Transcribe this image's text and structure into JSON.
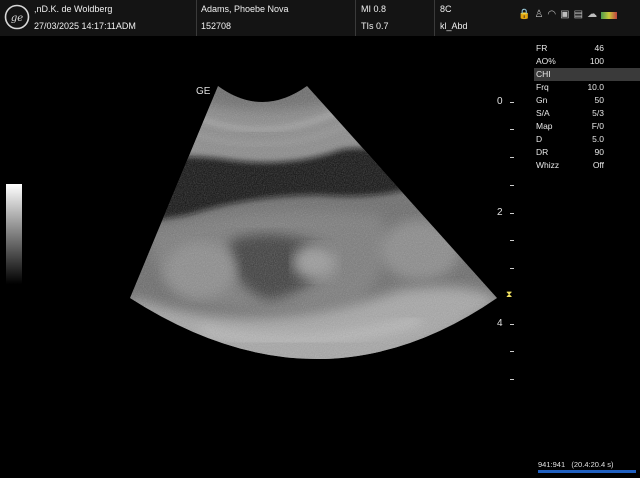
{
  "header": {
    "operator": ",nD.K. de Woldberg",
    "datetime": "27/03/2025 14:17:11ADM",
    "patient_name": "Adams, Phoebe Nova",
    "patient_id": "152708",
    "mi": "MI 0.8",
    "tis": "TIs 0.7",
    "probe": "8C",
    "preset": "kl_Abd"
  },
  "header_icons": [
    "lock-icon",
    "person-icon",
    "wifi-icon",
    "printer-icon",
    "image-store-icon",
    "cloud-icon",
    "palette-icon"
  ],
  "probe_mark": "GE",
  "depth_scale": [
    "0",
    "2",
    "4"
  ],
  "parameters": [
    {
      "label": "FR",
      "value": "46"
    },
    {
      "label": "AO%",
      "value": "100"
    },
    {
      "label": "CHI",
      "value": ""
    },
    {
      "label": "Frq",
      "value": "10.0"
    },
    {
      "label": "Gn",
      "value": "50"
    },
    {
      "label": "S/A",
      "value": "5/3"
    },
    {
      "label": "Map",
      "value": "F/0"
    },
    {
      "label": "D",
      "value": "5.0"
    },
    {
      "label": "DR",
      "value": "90"
    },
    {
      "label": "Whizz",
      "value": "Off"
    }
  ],
  "cine": {
    "frames": "941:941",
    "time": "(20.4:20.4 s)"
  },
  "colors": {
    "background": "#000000",
    "header": "#141414",
    "cine_bar": "#2060c0",
    "focus_marker": "#f0e060"
  }
}
